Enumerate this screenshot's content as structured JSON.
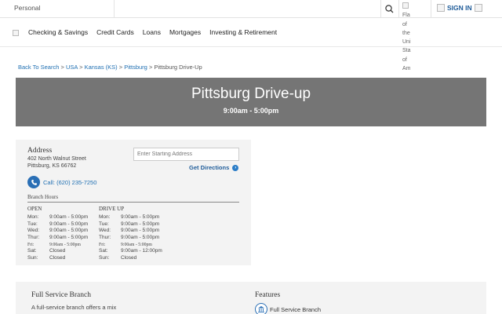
{
  "topbar": {
    "personal_label": "Personal",
    "flag_alt_lines": [
      "Fla",
      "of",
      "the",
      "Uni",
      "Sta",
      "of",
      "Am"
    ],
    "signin_label": "SIGN IN"
  },
  "nav": {
    "items": [
      "Checking & Savings",
      "Credit Cards",
      "Loans",
      "Mortgages",
      "Investing & Retirement"
    ]
  },
  "breadcrumb": {
    "links": [
      "Back To Search",
      "USA",
      "Kansas (KS)",
      "Pittsburg"
    ],
    "separator": ">",
    "current": "Pittsburg Drive-Up"
  },
  "hero": {
    "title": "Pittsburg Drive-up",
    "hours": "9:00am - 5:00pm"
  },
  "address": {
    "title": "Address",
    "line1": "402 North Walnut Street",
    "line2": "Pittsburg, KS 66762",
    "start_placeholder": "Enter Starting Address",
    "get_directions": "Get Directions",
    "call_label": "Call: (620) 235-7250"
  },
  "branch_hours": {
    "title": "Branch Hours",
    "open": {
      "heading": "OPEN",
      "rows": [
        {
          "day": "Mon:",
          "hours": "9:00am - 5:00pm"
        },
        {
          "day": "Tue:",
          "hours": "9:00am - 5:00pm"
        },
        {
          "day": "Wed:",
          "hours": "9:00am - 5:00pm"
        },
        {
          "day": "Thur:",
          "hours": "9:00am - 5:00pm"
        },
        {
          "day": "Fri:",
          "hours": "9:00am - 5:00pm"
        },
        {
          "day": "Sat:",
          "hours": "Closed"
        },
        {
          "day": "Sun:",
          "hours": "Closed"
        }
      ]
    },
    "drive_up": {
      "heading": "DRIVE UP",
      "rows": [
        {
          "day": "Mon:",
          "hours": "9:00am - 5:00pm"
        },
        {
          "day": "Tue:",
          "hours": "9:00am - 5:00pm"
        },
        {
          "day": "Wed:",
          "hours": "9:00am - 5:00pm"
        },
        {
          "day": "Thur:",
          "hours": "9:00am - 5:00pm"
        },
        {
          "day": "Fri:",
          "hours": "9:00am - 5:00pm"
        },
        {
          "day": "Sat:",
          "hours": "9:00am - 12:00pm"
        },
        {
          "day": "Sun:",
          "hours": "Closed"
        }
      ]
    }
  },
  "branch_info": {
    "title": "Full Service Branch",
    "description": "A full-service branch offers a mix",
    "features_title": "Features",
    "feature_item": "Full Service Branch"
  },
  "colors": {
    "link": "#1f6fb2",
    "hero_bg": "#757575",
    "card_bg": "#f3f3f3",
    "accent_blue": "#2a6fb5"
  }
}
